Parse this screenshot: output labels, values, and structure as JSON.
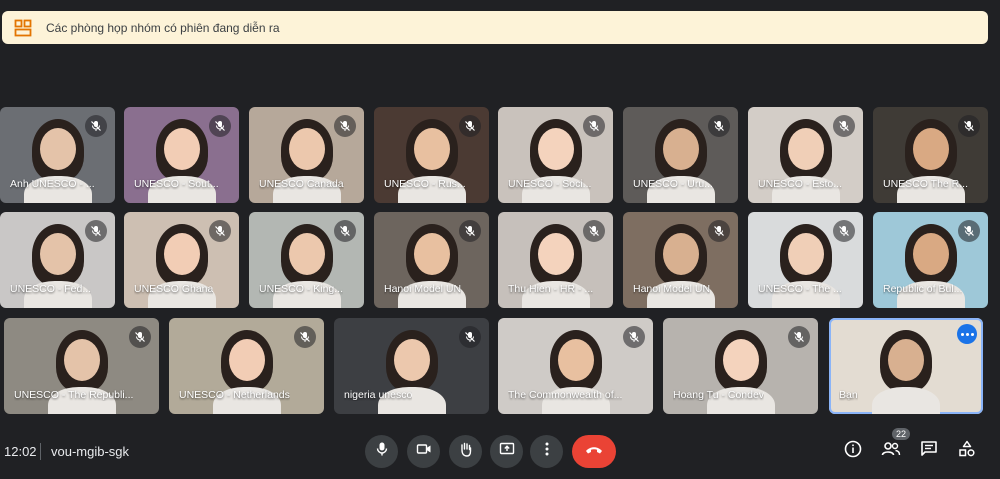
{
  "banner": {
    "text": "Các phòng họp nhóm có phiên đang diễn ra"
  },
  "participants": [
    "Anh UNESCO - ...",
    "UNESCO - Sout...",
    "UNESCO Canada",
    "UNESCO - Rus...",
    "UNESCO - Soci...",
    "UNESCO - Uru...",
    "UNESCO - Esto...",
    "UNESCO The R...",
    "UNESCO - Fed...",
    "UNESCO Ghana",
    "UNESCO - King...",
    "Hanoi Model UN",
    "Thu Hien - HR - ...",
    "Hanoi Model UN",
    "UNESCO - The ...",
    "Republic of Bul...",
    "UNESCO - The Republi...",
    "UNESCO - Netherlands",
    "nigeria unesco",
    "The Commonwealth of...",
    "Hoang Tu - Condev",
    "Bạn"
  ],
  "meeting": {
    "time": "12:02",
    "code": "vou-mgib-sgk"
  },
  "participant_count": "22",
  "icons": {
    "banner": "breakout-rooms-icon",
    "tile_mic": "mic-off-icon",
    "controls": [
      "mic-icon",
      "camera-icon",
      "raise-hand-icon",
      "present-screen-icon",
      "more-options-icon",
      "end-call-icon"
    ],
    "right": [
      "info-icon",
      "people-icon",
      "chat-icon",
      "activities-icon"
    ]
  },
  "colors": {
    "background": "#202124",
    "banner": "#fdf3d8",
    "end_call": "#ea4335",
    "self_outline": "#8ab4f8"
  }
}
